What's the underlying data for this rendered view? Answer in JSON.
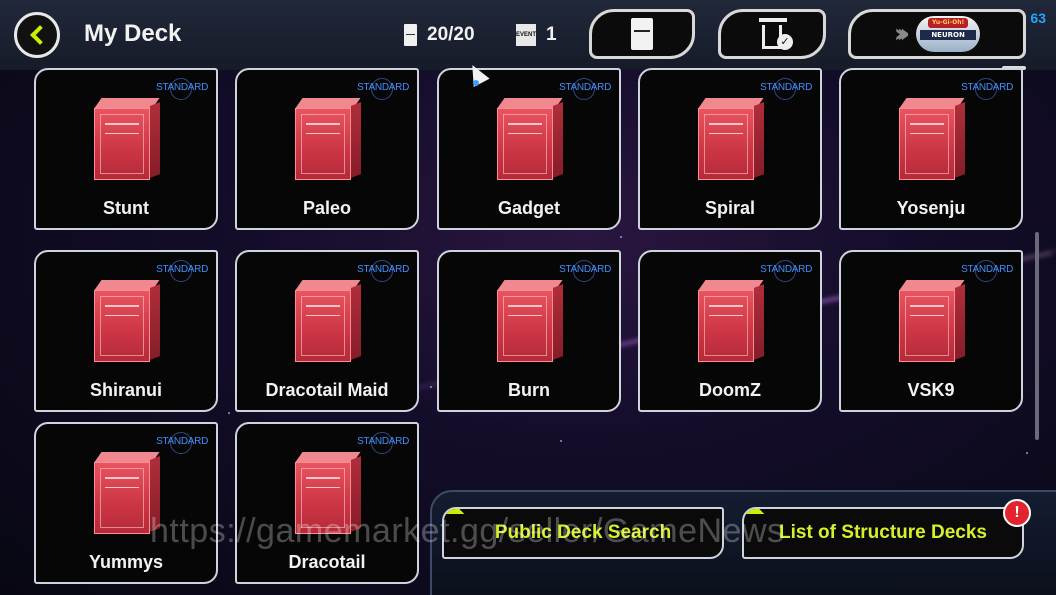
{
  "header": {
    "title": "My Deck",
    "deck_count": "20/20",
    "deck_count_icon": "deck-box-icon",
    "ticket_count": "1",
    "ticket_label": "EVENT",
    "ticket_icon": "event-ticket-icon",
    "create_deck_icon": "deck-box-icon",
    "delete_icon": "trash-check-icon",
    "neuron_link_label": "NEURON",
    "neuron_logo_text": "Yu-Gi-Oh!",
    "fps": "63"
  },
  "decks": [
    {
      "name": "Stunt",
      "format": "STANDARD"
    },
    {
      "name": "Paleo",
      "format": "STANDARD"
    },
    {
      "name": "Gadget",
      "format": "STANDARD"
    },
    {
      "name": "Spiral",
      "format": "STANDARD"
    },
    {
      "name": "Yosenju",
      "format": "STANDARD"
    },
    {
      "name": "Shiranui",
      "format": "STANDARD"
    },
    {
      "name": "Dracotail Maid",
      "format": "STANDARD"
    },
    {
      "name": "Burn",
      "format": "STANDARD"
    },
    {
      "name": "DoomZ",
      "format": "STANDARD"
    },
    {
      "name": "VSK9",
      "format": "STANDARD"
    },
    {
      "name": "Yummys",
      "format": "STANDARD"
    },
    {
      "name": "Dracotail",
      "format": "STANDARD"
    }
  ],
  "actions": {
    "public_search": "Public Deck Search",
    "structure_decks": "List of Structure Decks",
    "alert": "!"
  },
  "watermark": "https://gamemarket.gg/seller/GameNews",
  "colors": {
    "accent": "#c9f000",
    "standard_tag": "#3f8fff",
    "deck_box": "#cc3544"
  }
}
